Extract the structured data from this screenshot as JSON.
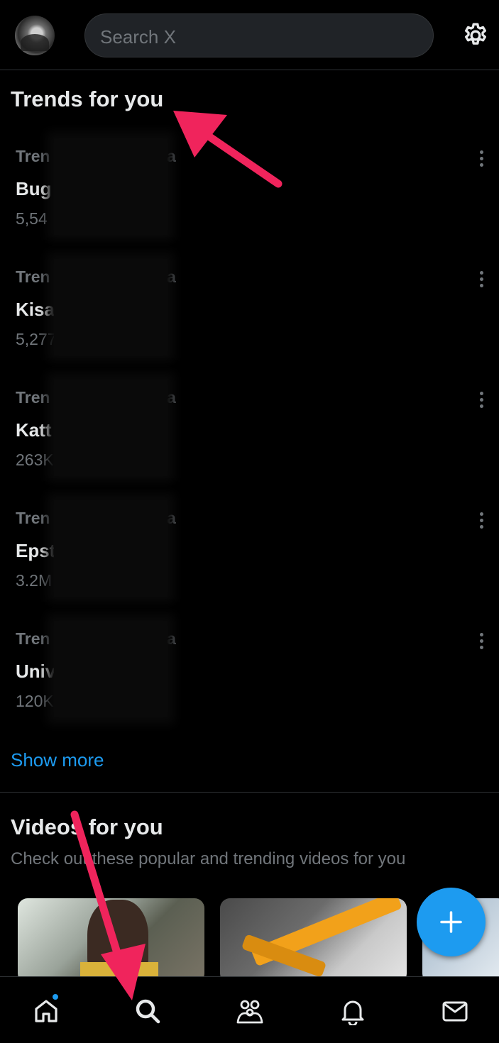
{
  "header": {
    "search_placeholder": "Search X",
    "avatar_icon": "user-avatar",
    "settings_icon": "gear-icon"
  },
  "trends": {
    "title": "Trends for you",
    "items": [
      {
        "label_start": "Tren",
        "label_end": "a",
        "name": "Bug",
        "count": "5,54"
      },
      {
        "label_start": "Tren",
        "label_end": "a",
        "name": "Kisa",
        "count": "5,277"
      },
      {
        "label_start": "Tren",
        "label_end": "a",
        "name": "Katt",
        "count": "263K"
      },
      {
        "label_start": "Tren",
        "label_end": "a",
        "name": "Epst",
        "count": "3.2M"
      },
      {
        "label_start": "Tren",
        "label_end": "a",
        "name": "Univ",
        "count": "120K"
      }
    ],
    "show_more": "Show more"
  },
  "videos": {
    "title": "Videos for you",
    "subtitle": "Check out these popular and trending videos for you"
  },
  "bottom_nav": {
    "items": [
      "home-icon",
      "search-icon",
      "communities-icon",
      "notifications-icon",
      "messages-icon"
    ]
  },
  "colors": {
    "accent": "#1d9bf0",
    "background": "#000000",
    "secondary_text": "#71767b",
    "annotation_arrow": "#f0245c"
  }
}
